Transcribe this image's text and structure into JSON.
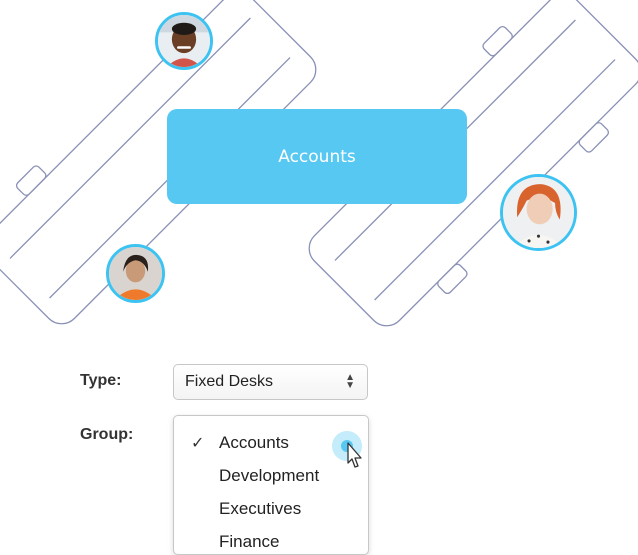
{
  "floorplan": {
    "group_banner": "Accounts",
    "colors": {
      "accent": "#56c8f2",
      "desk_outline": "#8a91b5",
      "avatar_ring": "#3cc3f2"
    },
    "avatars": [
      "person-avatar",
      "person-avatar",
      "person-avatar"
    ]
  },
  "form": {
    "type_label": "Type:",
    "type_value": "Fixed Desks",
    "group_label": "Group:",
    "group_options": [
      "Accounts",
      "Development",
      "Executives",
      "Finance"
    ],
    "group_selected": "Accounts"
  }
}
